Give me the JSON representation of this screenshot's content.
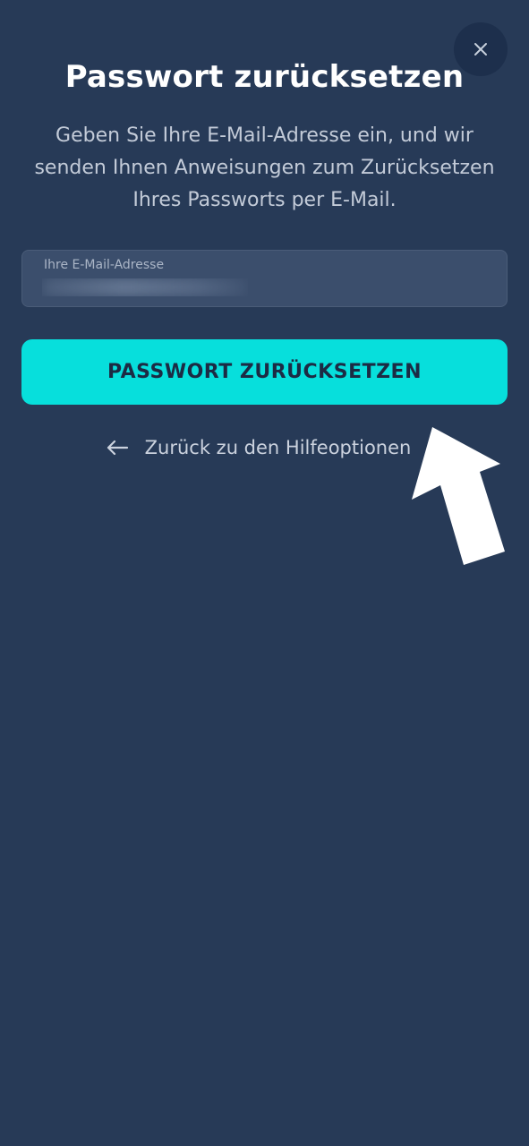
{
  "dialog": {
    "title": "Passwort zurücksetzen",
    "description": "Geben Sie Ihre E-Mail-Adresse ein, und wir senden Ihnen Anweisungen zum Zurücksetzen Ihres Passworts per E-Mail.",
    "close_icon": "close-icon"
  },
  "form": {
    "email_label": "Ihre E-Mail-Adresse",
    "email_value": "",
    "submit_label": "PASSWORT ZURÜCKSETZEN"
  },
  "back_link": {
    "label": "Zurück zu den Hilfeoptionen",
    "icon": "arrow-left-icon"
  },
  "overlay": {
    "pointer_icon": "pointer-arrow-icon"
  },
  "colors": {
    "background": "#273a57",
    "close_button": "#1d2f4c",
    "accent": "#07dfdc",
    "button_text": "#1c2b44",
    "input_bg": "#3b4e6c"
  }
}
